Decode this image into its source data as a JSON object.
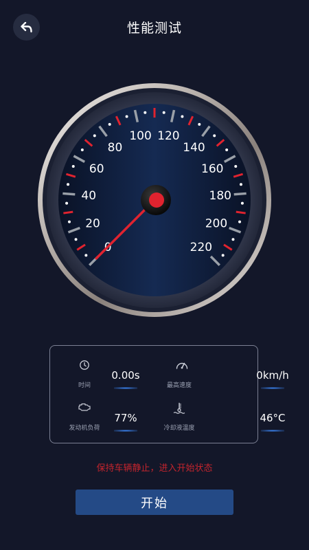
{
  "header": {
    "title": "性能测试",
    "back_icon": "back-arrow-icon"
  },
  "gauge": {
    "ticks": [
      "0",
      "20",
      "40",
      "60",
      "80",
      "100",
      "120",
      "140",
      "160",
      "180",
      "200",
      "220"
    ],
    "min": 0,
    "max": 220,
    "needle_value": 0,
    "accent_color": "#e0232f",
    "tick_color": "#9aa0a8"
  },
  "stats": {
    "time": {
      "label": "时间",
      "value": "0.00s",
      "icon": "clock-icon"
    },
    "max_speed": {
      "label": "最高速度",
      "value": "0km/h",
      "icon": "speedometer-icon"
    },
    "engine_load": {
      "label": "发动机负荷",
      "value": "77%",
      "icon": "engine-icon"
    },
    "coolant_temp": {
      "label": "冷却液温度",
      "value": "46°C",
      "icon": "thermometer-icon"
    }
  },
  "hint": "保持车辆静止，进入开始状态",
  "start_button": "开始"
}
